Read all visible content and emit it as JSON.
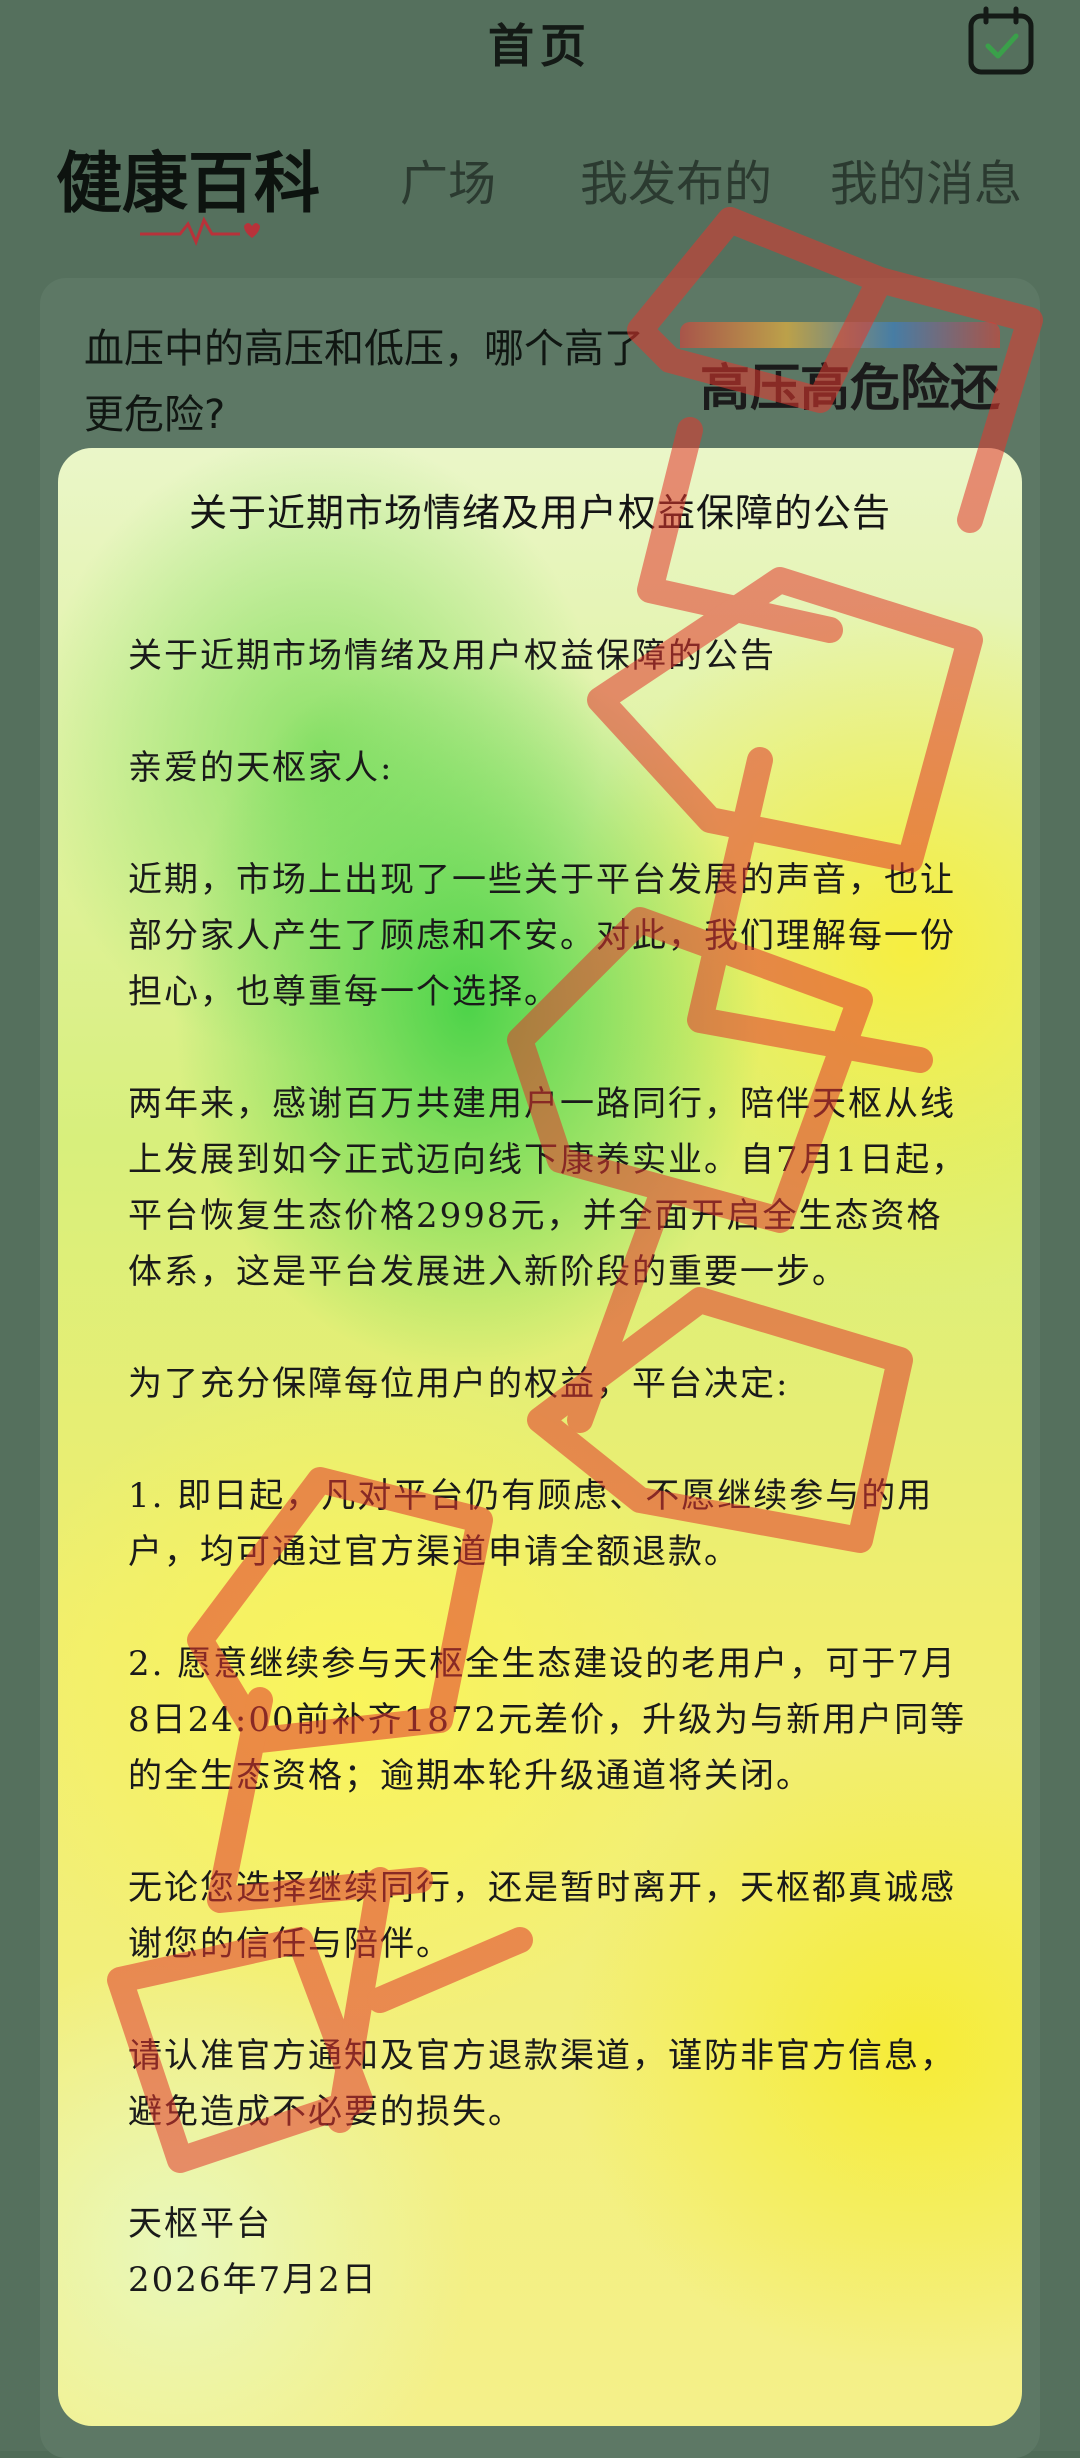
{
  "header": {
    "title": "首页"
  },
  "tabs": [
    {
      "label": "健康百科",
      "active": true
    },
    {
      "label": "广场",
      "active": false
    },
    {
      "label": "我发布的",
      "active": false
    },
    {
      "label": "我的消息",
      "active": false
    }
  ],
  "article": {
    "title": "血压中的高压和低压，哪个高了更危险?",
    "banner_text": "高压高危险还"
  },
  "modal": {
    "title": "关于近期市场情绪及用户权益保障的公告",
    "paragraphs": [
      "关于近期市场情绪及用户权益保障的公告",
      "亲爱的天枢家人:",
      "近期，市场上出现了一些关于平台发展的声音，也让部分家人产生了顾虑和不安。对此，我们理解每一份担心，也尊重每一个选择。",
      "两年来，感谢百万共建用户一路同行，陪伴天枢从线上发展到如今正式迈向线下康养实业。自7月1日起，平台恢复生态价格2998元，并全面开启全生态资格体系，这是平台发展进入新阶段的重要一步。",
      "为了充分保障每位用户的权益，平台决定:",
      "1. 即日起，凡对平台仍有顾虑、不愿继续参与的用户，均可通过官方渠道申请全额退款。",
      "2. 愿意继续参与天枢全生态建设的老用户，可于7月8日24:00前补齐1872元差价，升级为与新用户同等的全生态资格；逾期本轮升级通道将关闭。",
      "无论您选择继续同行，还是暂时离开，天枢都真诚感谢您的信任与陪伴。",
      "请认准官方通知及官方退款渠道，谨防非官方信息，避免造成不必要的损失。",
      "天枢平台",
      "2026年7月2日"
    ]
  },
  "watermark": {
    "text": "既割韭菜又收割"
  },
  "colors": {
    "watermark": "#e2372e",
    "modal_green": "#46d246",
    "modal_yellow": "#f6ec32"
  }
}
